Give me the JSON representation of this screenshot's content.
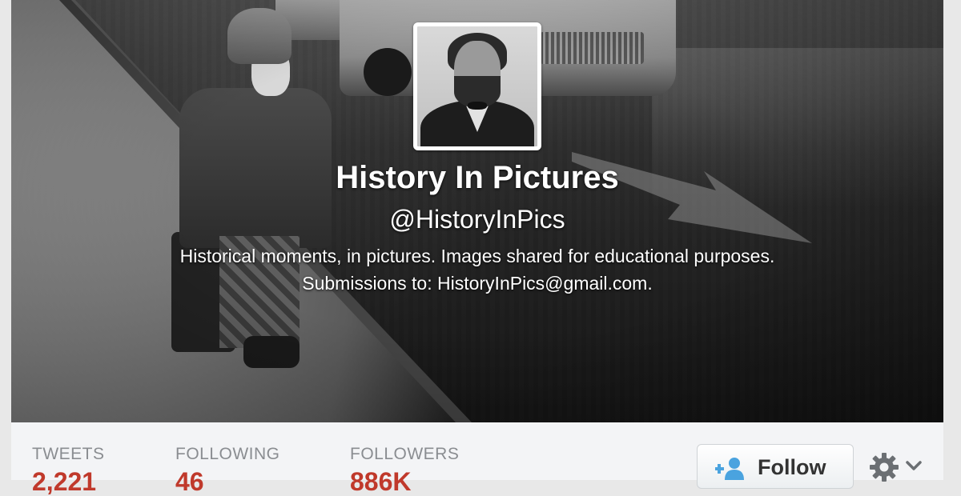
{
  "profile": {
    "name": "History In Pictures",
    "handle": "@HistoryInPics",
    "bio_line1": "Historical moments, in pictures. Images shared for educational purposes.",
    "bio_line2": "Submissions to: HistoryInPics@gmail.com."
  },
  "stats": {
    "tweets": {
      "label": "TWEETS",
      "value": "2,221"
    },
    "following": {
      "label": "FOLLOWING",
      "value": "46"
    },
    "followers": {
      "label": "FOLLOWERS",
      "value": "886K"
    }
  },
  "actions": {
    "follow_label": "Follow",
    "follow_icon": "add-user-icon",
    "settings_icon": "gear-icon"
  },
  "colors": {
    "stat_value": "#c0392b",
    "stat_label": "#8a8d91",
    "follow_icon": "#4aa3df"
  }
}
